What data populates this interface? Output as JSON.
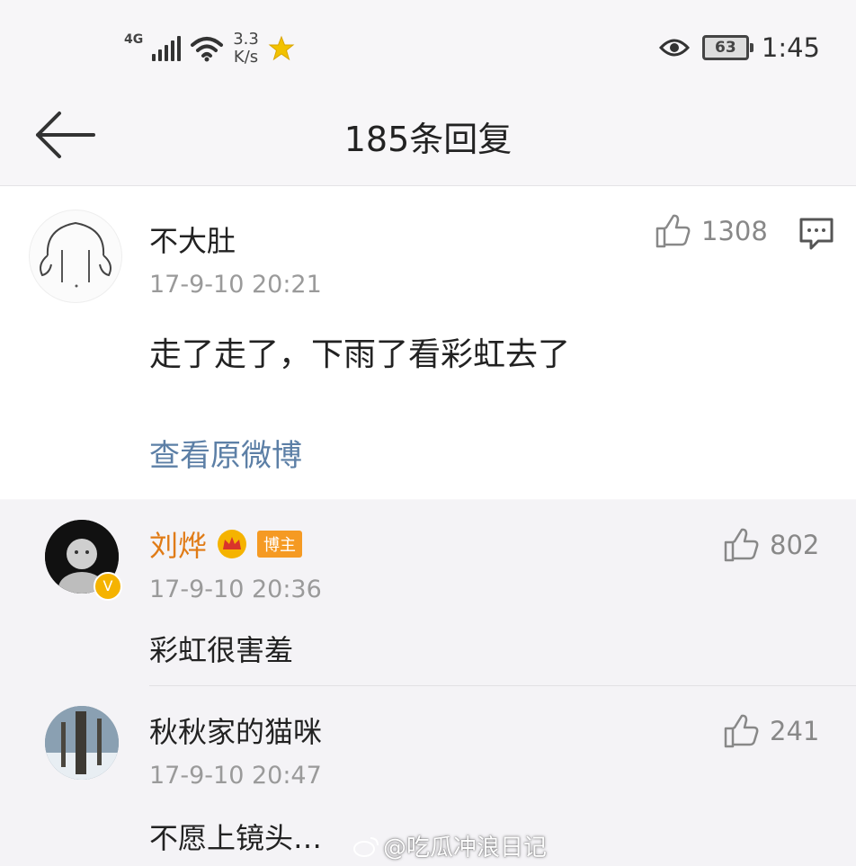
{
  "status_bar": {
    "network": "4G",
    "speed_value": "3.3",
    "speed_unit": "K/s",
    "battery": "63",
    "time": "1:45",
    "icons": [
      "signal-icon",
      "wifi-icon",
      "star-badge-icon",
      "eye-icon",
      "battery-icon"
    ]
  },
  "nav": {
    "title": "185条回复",
    "back_icon": "back-arrow-icon"
  },
  "main_comment": {
    "author": "不大肚",
    "time": "17-9-10 20:21",
    "content": "走了走了，下雨了看彩虹去了",
    "likes": "1308",
    "view_original": "查看原微博"
  },
  "replies": [
    {
      "author": "刘烨",
      "author_color": "#e07b16",
      "badge": "博主",
      "verified": true,
      "time": "17-9-10 20:36",
      "content": "彩虹很害羞",
      "likes": "802"
    },
    {
      "author": "秋秋家的猫咪",
      "author_color": "#222222",
      "time": "17-9-10 20:47",
      "content": "不愿上镜头…",
      "likes": "241"
    }
  ],
  "watermark": "@吃瓜冲浪日记",
  "colors": {
    "link": "#5c7fa6",
    "meta": "#9a9a9a",
    "accent_gold": "#f5b300",
    "badge_orange": "#f59a23"
  }
}
